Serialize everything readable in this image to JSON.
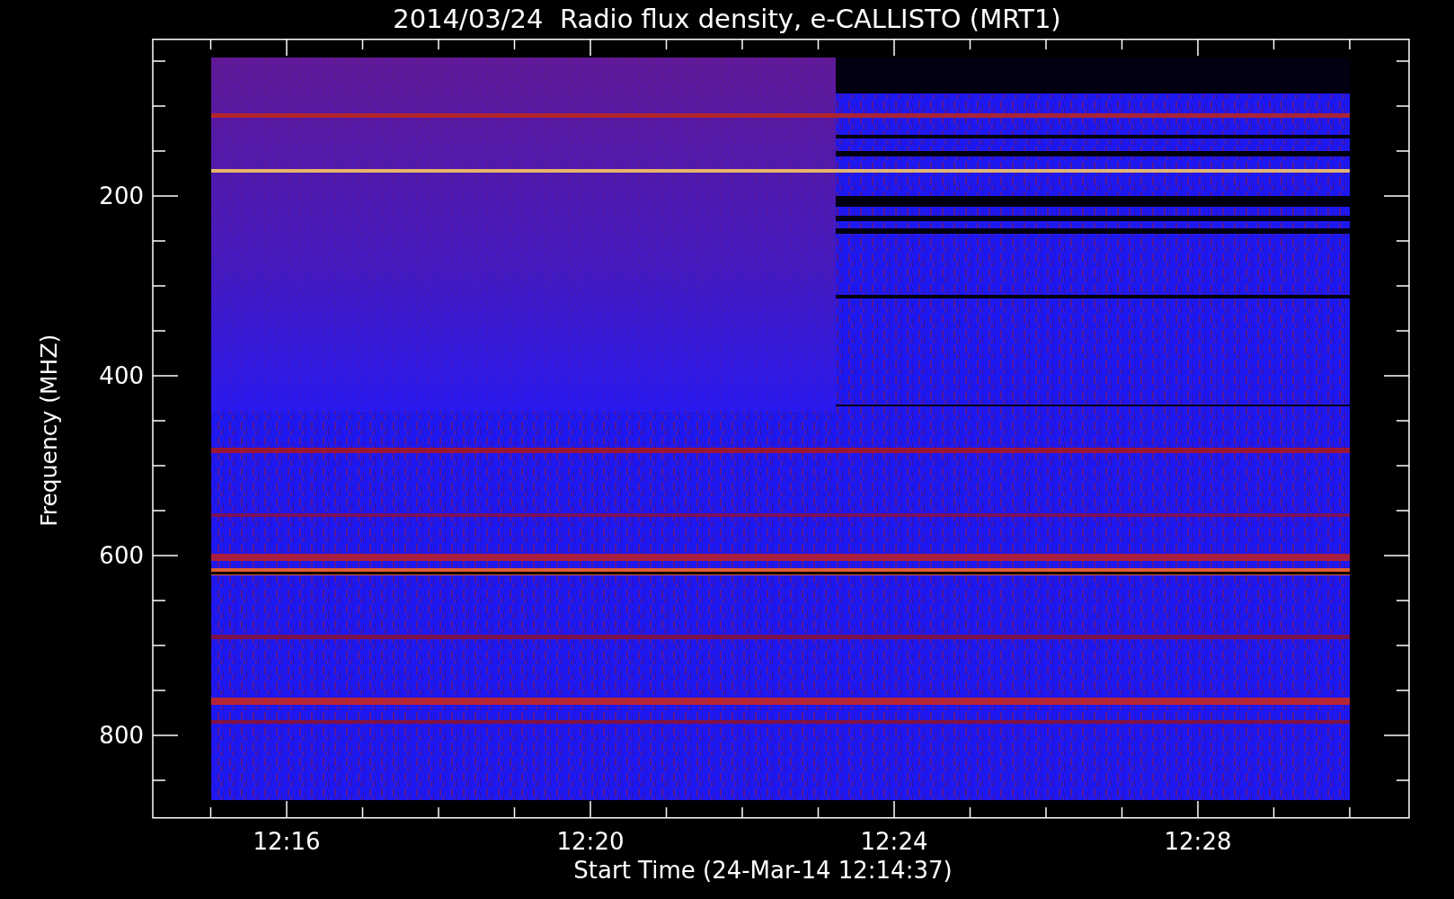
{
  "title": "2014/03/24  Radio flux density, e-CALLISTO (MRT1)",
  "plot": {
    "ylabel": "Frequency (MHZ)",
    "xlabel": "Start Time (24-Mar-14 12:14:37)",
    "yticks": [
      "200",
      "400",
      "600",
      "800"
    ],
    "xticks": [
      "12:16",
      "12:20",
      "12:24",
      "12:28"
    ]
  }
}
